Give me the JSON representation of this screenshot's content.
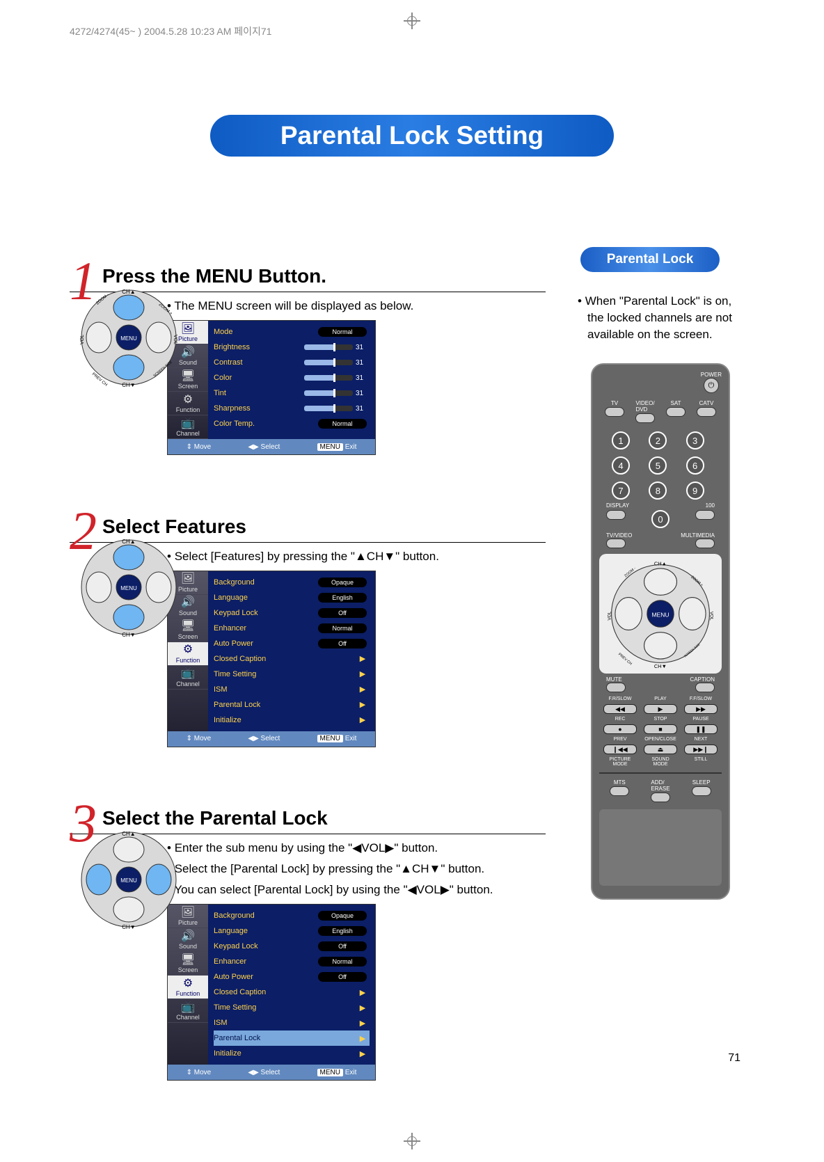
{
  "top_marker": "4272/4274(45~ ) 2004.5.28 10:23 AM 페이지71",
  "page_title": "Parental Lock Setting",
  "page_number": "71",
  "steps": [
    {
      "num": "1",
      "title": "Press the MENU Button.",
      "bullets": [
        "The MENU screen will be displayed as below."
      ]
    },
    {
      "num": "2",
      "title": "Select Features",
      "bullets": [
        "Select [Features] by pressing the \"▲CH▼\" button."
      ]
    },
    {
      "num": "3",
      "title": "Select the Parental Lock",
      "bullets": [
        "Enter the sub menu by using the \"◀VOL▶\" button.",
        "Select the [Parental Lock] by pressing the \"▲CH▼\" button.",
        "You can select [Parental Lock] by using the  \"◀VOL▶\" button."
      ]
    }
  ],
  "osd_footer": {
    "move": "Move",
    "select": "Select",
    "exit": "Exit",
    "menu_key": "MENU"
  },
  "osd_categories": [
    "Picture",
    "Sound",
    "Screen",
    "Function",
    "Channel"
  ],
  "osd1": {
    "sel_cat": 0,
    "rows": [
      {
        "label": "Mode",
        "pill": "Normal"
      },
      {
        "label": "Brightness",
        "slider": true,
        "num": "31"
      },
      {
        "label": "Contrast",
        "slider": true,
        "num": "31"
      },
      {
        "label": "Color",
        "slider": true,
        "num": "31"
      },
      {
        "label": "Tint",
        "slider": true,
        "num": "31"
      },
      {
        "label": "Sharpness",
        "slider": true,
        "num": "31"
      },
      {
        "label": "Color Temp.",
        "pill": "Normal"
      }
    ]
  },
  "osd2": {
    "sel_cat": 3,
    "rows": [
      {
        "label": "Background",
        "pill": "Opaque"
      },
      {
        "label": "Language",
        "pill": "English"
      },
      {
        "label": "Keypad Lock",
        "pill": "Off"
      },
      {
        "label": "Enhancer",
        "pill": "Normal"
      },
      {
        "label": "Auto Power",
        "pill": "Off"
      },
      {
        "label": "Closed Caption",
        "arrow": true
      },
      {
        "label": "Time Setting",
        "arrow": true
      },
      {
        "label": "ISM",
        "arrow": true
      },
      {
        "label": "Parental Lock",
        "arrow": true
      },
      {
        "label": "Initialize",
        "arrow": true
      }
    ]
  },
  "osd3": {
    "sel_cat": 3,
    "sel_row": 8,
    "rows": [
      {
        "label": "Background",
        "pill": "Opaque"
      },
      {
        "label": "Language",
        "pill": "English"
      },
      {
        "label": "Keypad Lock",
        "pill": "Off"
      },
      {
        "label": "Enhancer",
        "pill": "Normal"
      },
      {
        "label": "Auto Power",
        "pill": "Off"
      },
      {
        "label": "Closed Caption",
        "arrow": true
      },
      {
        "label": "Time Setting",
        "arrow": true
      },
      {
        "label": "ISM",
        "arrow": true
      },
      {
        "label": "Parental Lock",
        "arrow": true
      },
      {
        "label": "Initialize",
        "arrow": true
      }
    ]
  },
  "right": {
    "pill": "Parental Lock",
    "note": "When \"Parental Lock\" is on, the locked channels are not available on the screen."
  },
  "remote": {
    "power": "POWER",
    "sources": [
      "TV",
      "VIDEO/\nDVD",
      "SAT",
      "CATV"
    ],
    "numbers": [
      "1",
      "2",
      "3",
      "4",
      "5",
      "6",
      "7",
      "8",
      "9",
      "0"
    ],
    "display": "DISPLAY",
    "hundred": "100",
    "tvvideo": "TV/VIDEO",
    "multimedia": "MULTIMEDIA",
    "dpad": {
      "up": "CH▲",
      "down": "CH▼",
      "left": "VOL",
      "right": "VOL",
      "center": "MENU",
      "ul": "ZOOM -",
      "ur": "ZOOM +",
      "ll": "PREV CH",
      "lr": "SCREEN SIZE"
    },
    "row_labels_1": [
      "MUTE",
      "",
      "CAPTION"
    ],
    "media_rows": [
      [
        "F.R/SLOW",
        "PLAY",
        "F.F/SLOW"
      ],
      [
        "◀◀",
        "▶",
        "▶▶"
      ],
      [
        "REC",
        "STOP",
        "PAUSE"
      ],
      [
        "●",
        "■",
        "❚❚"
      ],
      [
        "PREV",
        "OPEN/CLOSE",
        "NEXT"
      ],
      [
        "❙◀◀",
        "⏏",
        "▶▶❙"
      ],
      [
        "PICTURE\nMODE",
        "SOUND\nMODE",
        "STILL"
      ]
    ],
    "bottom": [
      "MTS",
      "ADD/\nERASE",
      "SLEEP"
    ]
  }
}
